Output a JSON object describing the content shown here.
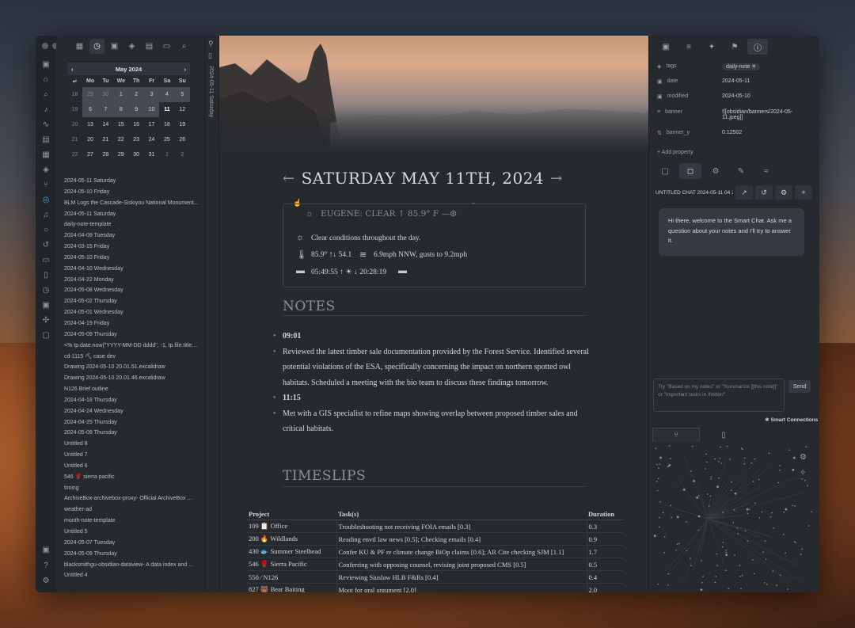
{
  "calendar": {
    "month_label": "May 2024",
    "weekdays": [
      "Mo",
      "Tu",
      "We",
      "Th",
      "Fr",
      "Sa",
      "Su"
    ],
    "weeks": [
      {
        "wk": "18",
        "days": [
          "29",
          "30",
          "1",
          "2",
          "3",
          "4",
          "5"
        ]
      },
      {
        "wk": "19",
        "days": [
          "6",
          "7",
          "8",
          "9",
          "10",
          "11",
          "12"
        ]
      },
      {
        "wk": "20",
        "days": [
          "13",
          "14",
          "15",
          "16",
          "17",
          "18",
          "19"
        ]
      },
      {
        "wk": "21",
        "days": [
          "20",
          "21",
          "22",
          "23",
          "24",
          "25",
          "26"
        ]
      },
      {
        "wk": "22",
        "days": [
          "27",
          "28",
          "29",
          "30",
          "31",
          "1",
          "2"
        ]
      }
    ]
  },
  "recent_files": [
    "2024-05-11 Saturday",
    "2024-05-10 Friday",
    "BLM Logs the Cascade-Siskiyou National Monument...",
    "2024-05-11 Saturday",
    "daily-note-template",
    "2024-04-09 Tuesday",
    "2024-03-15 Friday",
    "2024-05-10 Friday",
    "2024-04-10 Wednesday",
    "2024-04-22 Monday",
    "2024-05-08 Wednesday",
    "2024-05-02 Thursday",
    "2024-05-01 Wednesday",
    "2024-04-19 Friday",
    "2024-05-09 Thursday",
    "<% tp.date.now(\"YYYY-MM-DD dddd\", -1, tp.file.title, ...",
    "cd-1115 ⛏ case dev",
    "Drawing 2024-05-10 20.01.51.excalidraw",
    "Drawing 2024-05-10 20.01.46.excalidraw",
    "N126 Brief outline",
    "2024-04-18 Thursday",
    "2024-04-24 Wednesday",
    "2024-04-25 Thursday",
    "2024-05-09 Thursday",
    "Untitled 8",
    "Untitled 7",
    "Untitled 6",
    "546 🌹 sierra pacific",
    "timing",
    "ArchiveBox-archivebox-proxy- Official ArchiveBox ...",
    "weather-ad",
    "month-note-template",
    "Untitled 5",
    "2024-05-07 Tuesday",
    "2024-05-09 Thursday",
    "blacksmithgu-obsidian-dataview- A data index and ...",
    "Untitled 4"
  ],
  "file_strip": {
    "note_title": "2024-05-11 Saturday"
  },
  "note": {
    "title": "SATURDAY MAY 11TH, 2024",
    "prev_arrow": "←",
    "next_arrow": "→",
    "weather": {
      "header": "EUGENE: CLEAR ↑ 85.9° F —",
      "conditions": "Clear conditions throughout the day.",
      "temp": "85.9° ↑↓ 54.1",
      "wind": "6.9mph NNW, gusts to 9.2mph",
      "sunrise": "05:49:55 ↑ ☀ ↓ 20:28:19"
    },
    "notes_heading": "NOTES",
    "notes": [
      {
        "time": "09:01",
        "text": "Reviewed the latest timber sale documentation provided by the Forest Service. Identified several potential violations of the ESA, specifically concerning the impact on northern spotted owl habitats. Scheduled a meeting with the bio team to discuss these findings tomorrow."
      },
      {
        "time": "11:15",
        "text": "Met with a GIS specialist to refine maps showing overlap between proposed timber sales and critical habitats."
      }
    ],
    "timeslips_heading": "TIMESLIPS",
    "timeslips": {
      "headers": [
        "Project",
        "Task(s)",
        "Duration"
      ],
      "rows": [
        [
          "109 📋 Office",
          "Troubleshooting not receiving FOIA emails [0.3]",
          "0.3"
        ],
        [
          "200 🔥 Wildlands",
          "Reading envtl law news [0.5]; Checking emails [0.4]",
          "0.9"
        ],
        [
          "430 🐟 Summer Steelhead",
          "Confer KU & PF re climate change BiOp claims [0.6]; AR Cite checking SJM [1.1]",
          "1.7"
        ],
        [
          "546 🌹 Sierra Pacific",
          "Conferring with opposing counsel, revising joint proposed CMS [0.5]",
          "0.5"
        ],
        [
          "550 ⁄ N126",
          "Reviewing Siuslaw HLB F&Rs [0.4]",
          "0.4"
        ],
        [
          "827 🐻 Bear Baiting",
          "Moot for oral argument [2.0]",
          "2.0"
        ]
      ]
    }
  },
  "properties": {
    "rows": [
      {
        "key": "tags",
        "value": "daily-note ✕"
      },
      {
        "key": "date",
        "value": "2024-05-11"
      },
      {
        "key": "modified",
        "value": "2024-05-10"
      },
      {
        "key": "banner",
        "value": "![[obsidian/banners/2024-05-11.jpeg]]"
      },
      {
        "key": "banner_y",
        "value": "0.12502"
      }
    ],
    "add_label": "+ Add property"
  },
  "smart_chat": {
    "chat_name": "UNTITLED CHAT 2024-05-11 04 2",
    "welcome": "Hi there, welcome to the Smart Chat. Ask me a question about your notes and I'll try to answer it.",
    "placeholder": "Try \"Based on my notes\" or \"Summarize [[this note]]\" or \"Important tasks in /folder/\"",
    "send_label": "Send",
    "connections_label": "Smart Connections"
  },
  "colors": {
    "window_bg": "#262a2f",
    "ribbon_bg": "#21252a",
    "accent": "#353a40"
  }
}
